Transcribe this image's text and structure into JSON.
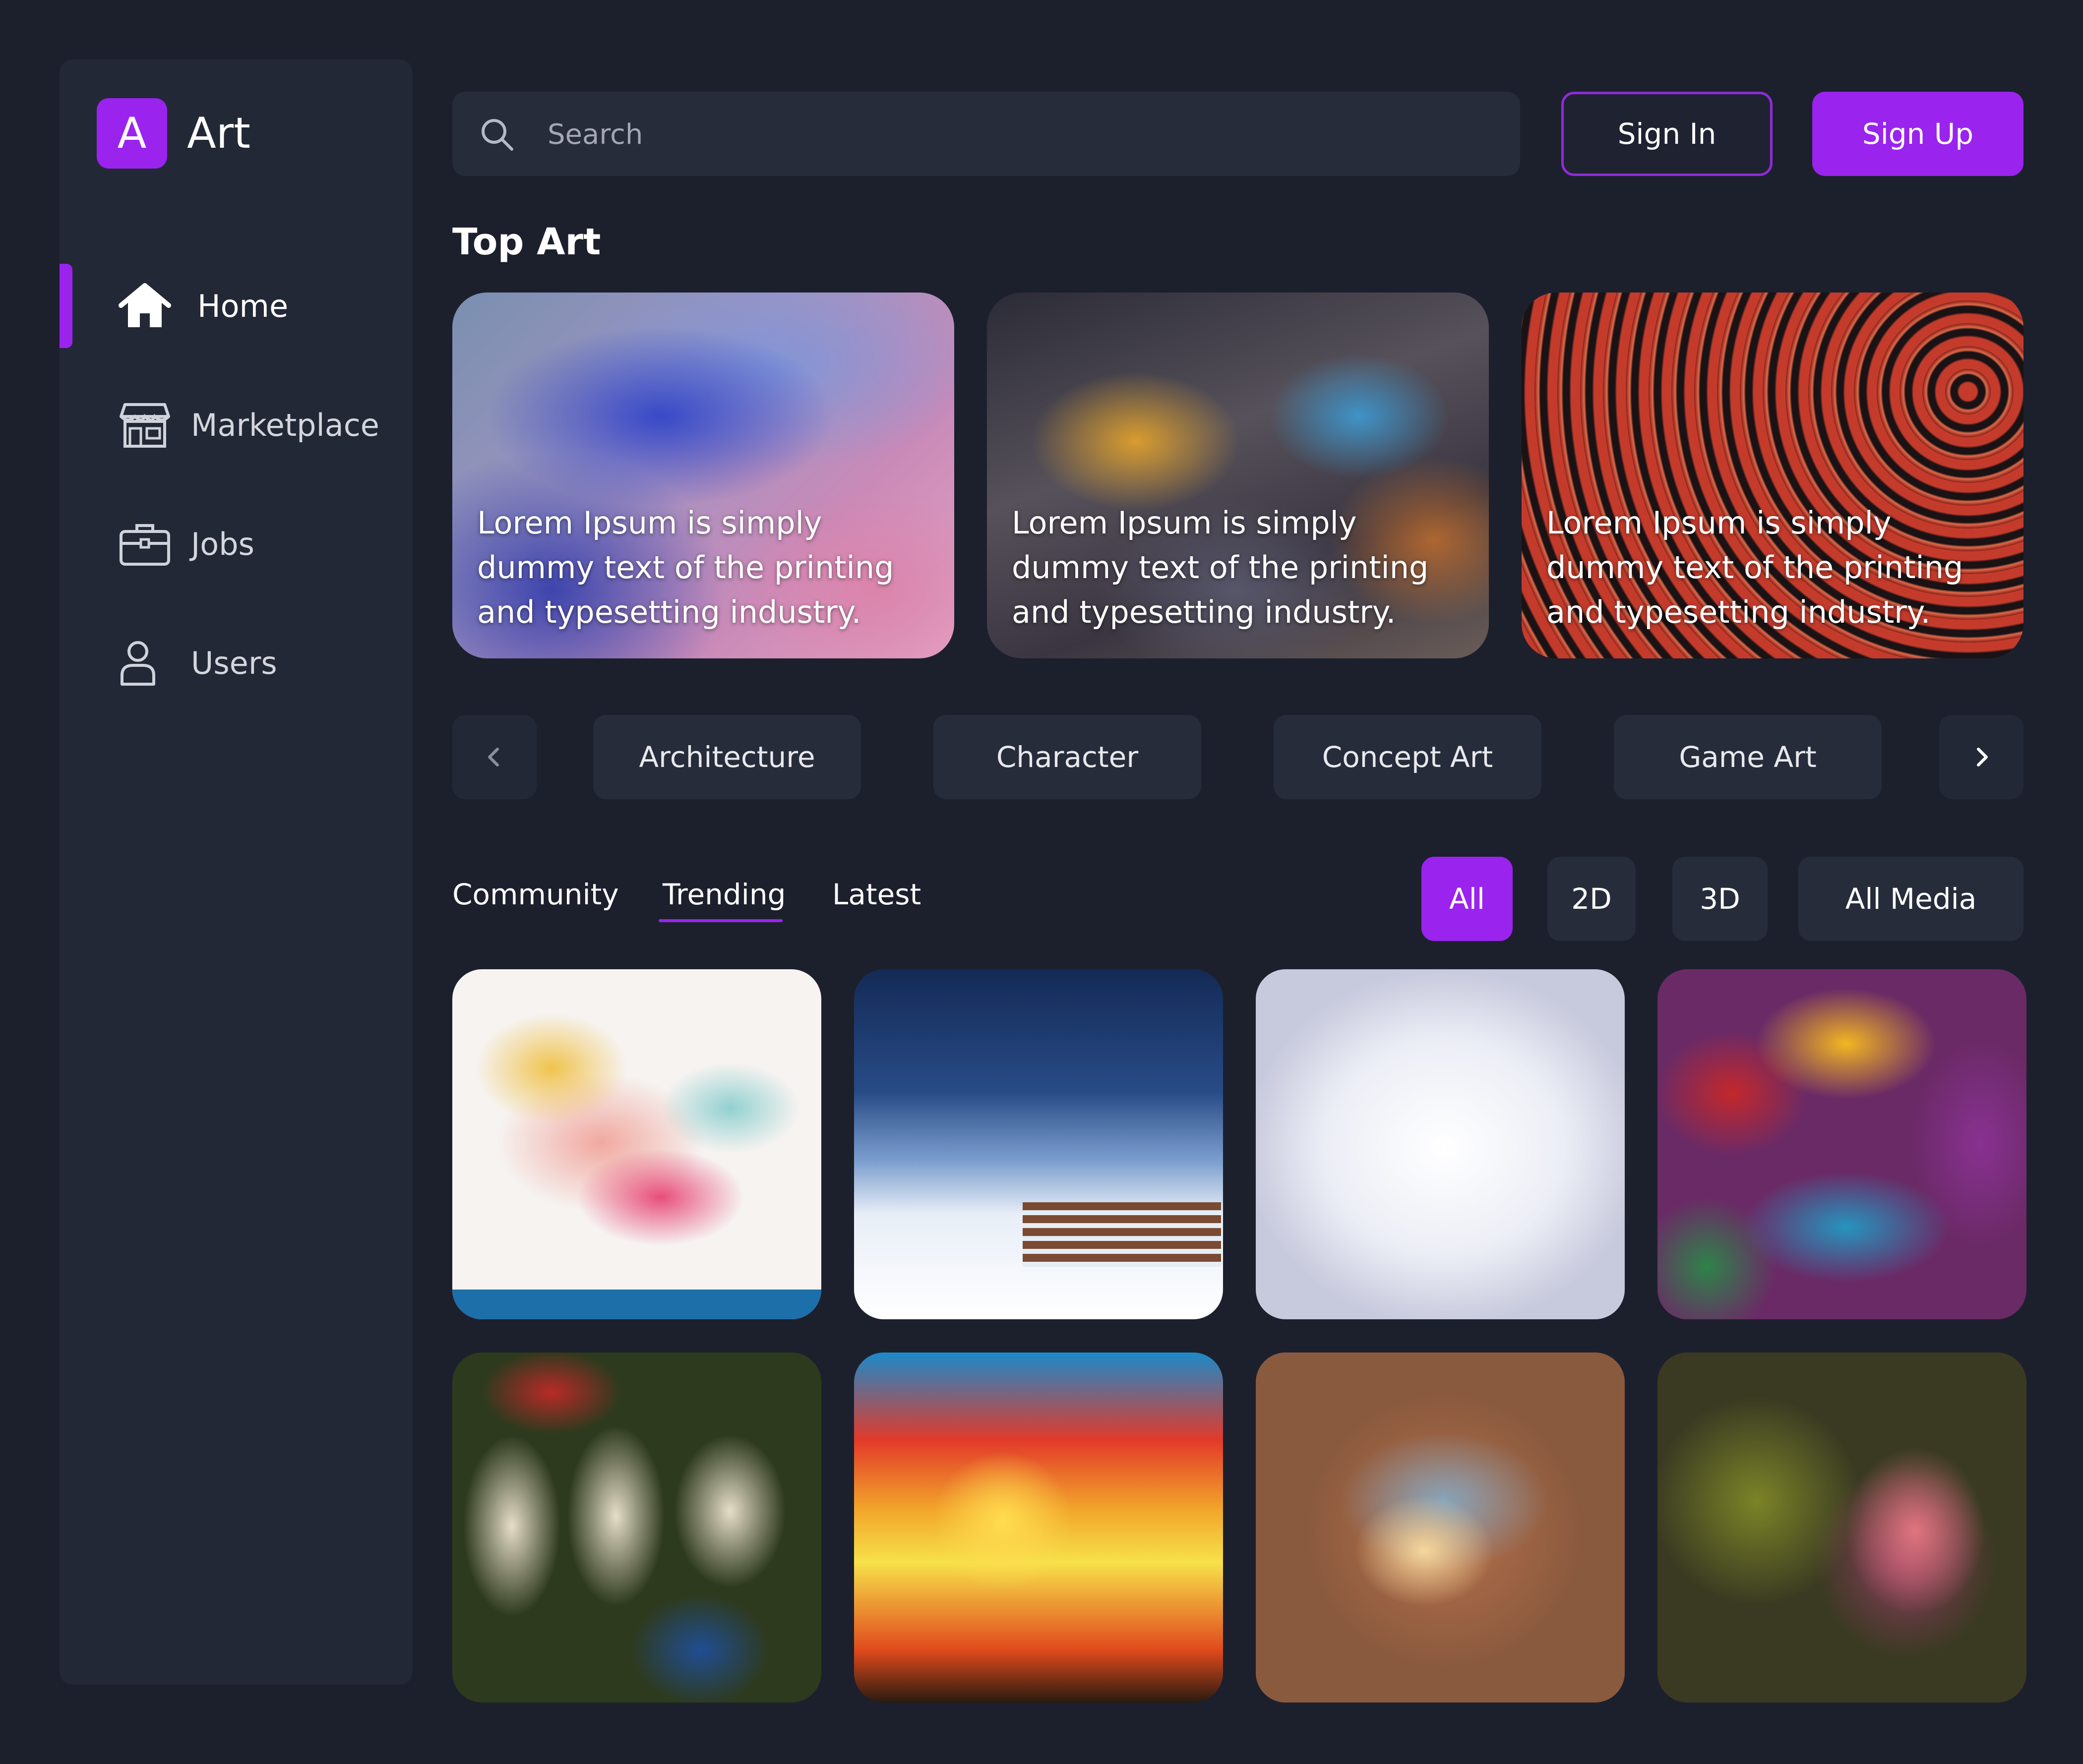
{
  "brand": {
    "mark": "A",
    "name": "Art"
  },
  "sidebar": {
    "items": [
      {
        "label": "Home",
        "icon": "home-icon",
        "active": true
      },
      {
        "label": "Marketplace",
        "icon": "store-icon",
        "active": false
      },
      {
        "label": "Jobs",
        "icon": "briefcase-icon",
        "active": false
      },
      {
        "label": "Users",
        "icon": "user-icon",
        "active": false
      }
    ]
  },
  "header": {
    "search_placeholder": "Search",
    "sign_in_label": "Sign In",
    "sign_up_label": "Sign Up"
  },
  "top_art": {
    "title": "Top Art",
    "cards": [
      {
        "caption": "Lorem Ipsum is simply dummy text of the printing and typesetting industry."
      },
      {
        "caption": "Lorem Ipsum is simply dummy text of the printing and typesetting industry."
      },
      {
        "caption": "Lorem Ipsum is simply dummy text of the printing and typesetting industry."
      }
    ]
  },
  "categories": [
    "Architecture",
    "Character",
    "Concept Art",
    "Game Art"
  ],
  "feed_tabs": {
    "items": [
      "Community",
      "Trending",
      "Latest"
    ],
    "active": "Trending"
  },
  "media_filters": {
    "items": [
      "All",
      "2D",
      "3D",
      "All Media"
    ],
    "active": "All"
  },
  "colors": {
    "background": "#1c202d",
    "panel": "#232836",
    "accent": "#9a23ee"
  }
}
